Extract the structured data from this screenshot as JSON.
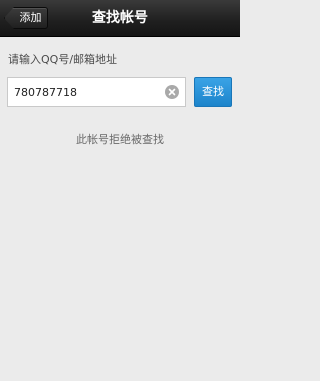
{
  "header": {
    "back_label": "添加",
    "title": "查找帐号"
  },
  "search": {
    "prompt": "请输入QQ号/邮箱地址",
    "value": "780787718",
    "clear_icon": "clear-icon",
    "button_label": "查找"
  },
  "result": {
    "message": "此帐号拒绝被查找"
  },
  "colors": {
    "titlebar": "#1f1f1f",
    "background": "#ebebeb",
    "button_blue": "#2a93d8"
  }
}
